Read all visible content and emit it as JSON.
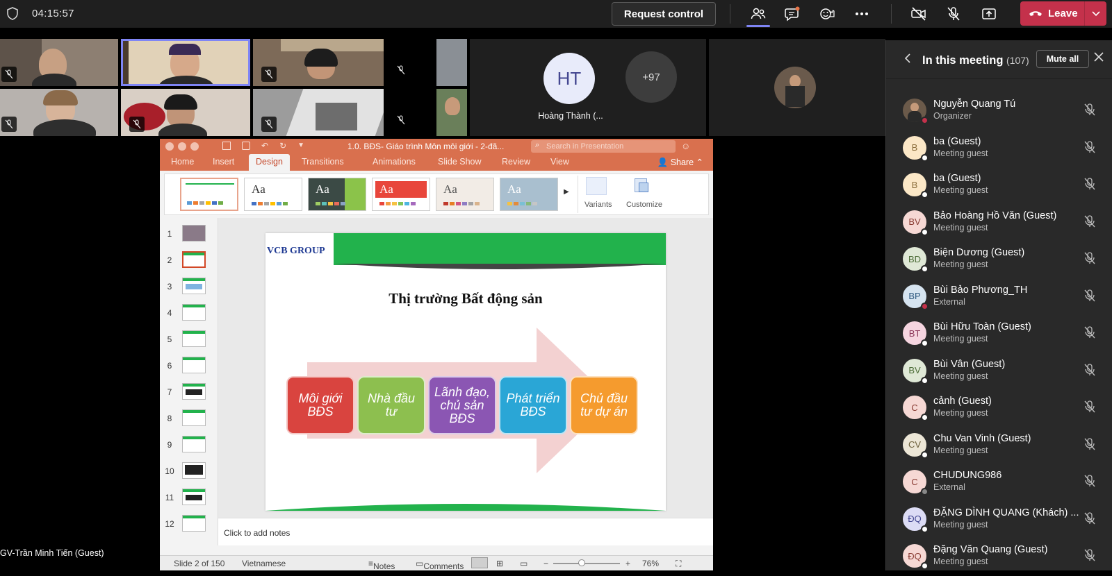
{
  "topbar": {
    "timer": "04:15:57",
    "request_control": "Request control",
    "leave": "Leave",
    "colors": {
      "leave": "#c4314b",
      "accent": "#7f85f5"
    }
  },
  "video": {
    "ht_initials": "HT",
    "ht_name": "Hoàng Thành (...",
    "overflow": "+97",
    "bottom_name": "GV-Trần Minh Tiến (Guest)"
  },
  "ppt": {
    "filename": "1.0. BĐS- Giáo trình Môn môi giới - 2-đã...",
    "search_placeholder": "Search in Presentation",
    "tabs": [
      "Home",
      "Insert",
      "Design",
      "Transitions",
      "Animations",
      "Slide Show",
      "Review",
      "View"
    ],
    "share": "Share",
    "theme_aa": "Aa",
    "variants": "Variants",
    "customize": "Customize",
    "thumb_numbers": [
      "1",
      "2",
      "3",
      "4",
      "5",
      "6",
      "7",
      "8",
      "9",
      "10",
      "11",
      "12"
    ],
    "slide": {
      "logo": "VCB GROUP",
      "title": "Thị trường Bất động sản",
      "boxes": [
        "Môi giới BĐS",
        "Nhà đầu tư",
        "Lãnh đạo, chủ sản BĐS",
        "Phát triển BĐS",
        "Chủ đầu tư dự án"
      ]
    },
    "notes_placeholder": "Click to add notes",
    "status": {
      "slide": "Slide 2 of 150",
      "language": "Vietnamese",
      "notes": "Notes",
      "comments": "Comments",
      "zoom": "76%"
    }
  },
  "panel": {
    "title": "In this meeting",
    "count": "(107)",
    "mute_all": "Mute all",
    "participants": [
      {
        "initials": "",
        "name": "Nguyễn Quang Tú",
        "role": "Organizer",
        "bg": "#6b5a4a",
        "fg": "#fff",
        "status": "#c4314b"
      },
      {
        "initials": "B",
        "name": "ba (Guest)",
        "role": "Meeting guest",
        "bg": "#fbe7c6",
        "fg": "#8a6d3b",
        "status": "#ffffff"
      },
      {
        "initials": "B",
        "name": "ba (Guest)",
        "role": "Meeting guest",
        "bg": "#fbe7c6",
        "fg": "#8a6d3b",
        "status": "#ffffff"
      },
      {
        "initials": "BV",
        "name": "Bảo Hoàng Hồ Văn (Guest)",
        "role": "Meeting guest",
        "bg": "#f6d8d4",
        "fg": "#8a3d34",
        "status": "#ffffff"
      },
      {
        "initials": "BD",
        "name": "Biện Dương (Guest)",
        "role": "Meeting guest",
        "bg": "#dfe8d6",
        "fg": "#4a6b35",
        "status": "#ffffff"
      },
      {
        "initials": "BP",
        "name": "Bùi Bảo Phương_TH",
        "role": "External",
        "bg": "#d6e4f0",
        "fg": "#2f5a80",
        "status": "#c4314b"
      },
      {
        "initials": "BT",
        "name": "Bùi Hữu Toàn (Guest)",
        "role": "Meeting guest",
        "bg": "#f6d5e0",
        "fg": "#8a3558",
        "status": "#ffffff"
      },
      {
        "initials": "BV",
        "name": "Bùi Vân (Guest)",
        "role": "Meeting guest",
        "bg": "#dfe8d6",
        "fg": "#4a6b35",
        "status": "#ffffff"
      },
      {
        "initials": "C",
        "name": "cảnh (Guest)",
        "role": "Meeting guest",
        "bg": "#f6d8d4",
        "fg": "#8a3d34",
        "status": "#ffffff"
      },
      {
        "initials": "CV",
        "name": "Chu Van Vinh (Guest)",
        "role": "Meeting guest",
        "bg": "#ece6d6",
        "fg": "#6b5e3a",
        "status": "#ffffff"
      },
      {
        "initials": "C",
        "name": "CHUDUNG986",
        "role": "External",
        "bg": "#f6d8d4",
        "fg": "#8a3d34",
        "status": "#888888"
      },
      {
        "initials": "ĐQ",
        "name": "ĐẶNG DÌNH QUANG (Khách) ...",
        "role": "Meeting guest",
        "bg": "#dcdcf5",
        "fg": "#444791",
        "status": "#ffffff"
      },
      {
        "initials": "ĐQ",
        "name": "Đặng Văn Quang (Guest)",
        "role": "Meeting guest",
        "bg": "#f6d8d4",
        "fg": "#8a3d34",
        "status": "#ffffff"
      }
    ]
  }
}
